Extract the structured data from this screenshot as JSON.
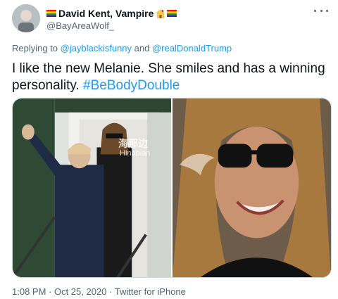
{
  "author": {
    "display_name": "David Kent, Vampire",
    "handle": "@BayAreaWolf_"
  },
  "reply_context": {
    "prefix": "Replying to",
    "mention_1": "@jayblackisfunny",
    "joiner": "and",
    "mention_2": "@realDonaldTrump"
  },
  "tweet": {
    "text": "I like the new Melanie. She smiles and has a winning personality. ",
    "hashtag": "#BeBodyDouble"
  },
  "media": {
    "watermark_text": "海那边",
    "watermark_sub": "Hinabian"
  },
  "meta": {
    "timestamp": "1:08 PM · Oct 25, 2020 · Twitter for iPhone"
  },
  "icons": {
    "flag": "rainbow-flag-icon",
    "house": "house-icon",
    "more": "more-options-icon"
  },
  "colors": {
    "link": "#1d9bf0",
    "secondary_text": "#536471",
    "primary_text": "#0f1419"
  }
}
